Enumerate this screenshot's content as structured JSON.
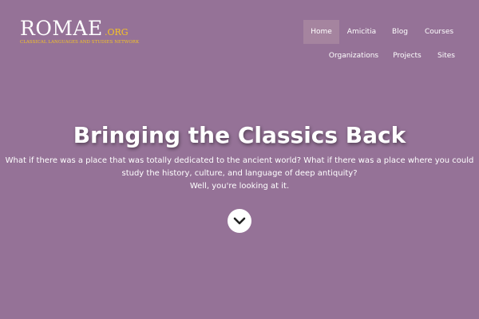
{
  "logo": {
    "name": "ROMAE",
    "suffix": ".ORG",
    "tagline": "CLASSICAL LANGUAGES AND STUDIES NETWORK"
  },
  "nav": {
    "items": [
      {
        "label": "Home",
        "active": true
      },
      {
        "label": "Amicitia",
        "active": false
      },
      {
        "label": "Blog",
        "active": false
      },
      {
        "label": "Courses",
        "active": false
      },
      {
        "label": "Organizations",
        "active": false
      },
      {
        "label": "Projects",
        "active": false
      },
      {
        "label": "Sites",
        "active": false
      }
    ]
  },
  "hero": {
    "title": "Bringing the Classics Back",
    "line1": "What if there was a place that was totally dedicated to the ancient world? What if there was a place where you could",
    "line2": "study the history, culture, and language of deep antiquity?",
    "line3": "Well, you're looking at it.",
    "scroll_icon": "chevron-down-icon"
  },
  "colors": {
    "background": "#957297",
    "active_nav": "#a5849f",
    "logo_accent": "#f6c325"
  }
}
